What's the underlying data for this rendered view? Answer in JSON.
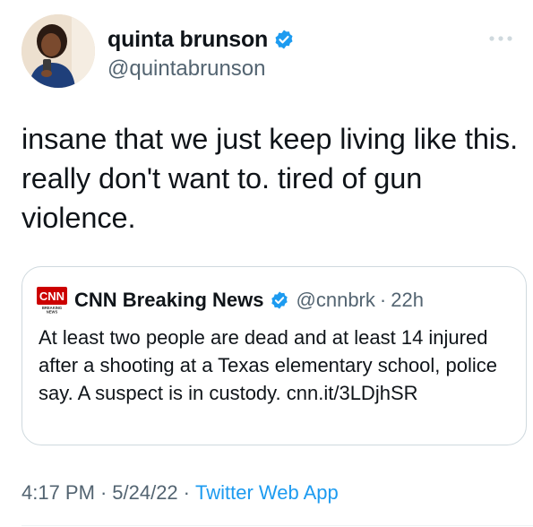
{
  "tweet": {
    "author": {
      "display_name": "quinta brunson",
      "handle": "@quintabrunson",
      "verified": true
    },
    "more_icon": "more-horizontal-icon",
    "text": "insane that we just keep living like this. really don't want to. tired of gun violence.",
    "quoted": {
      "logo_text": "CNN",
      "logo_subtext": "BREAKING NEWS",
      "display_name": "CNN Breaking News",
      "handle": "@cnnbrk",
      "separator": "·",
      "time": "22h",
      "text": "At least two people are dead and at least 14 injured after a shooting at a Texas elementary school, police say. A suspect is in custody. cnn.it/3LDjhSR"
    },
    "meta": {
      "time": "4:17 PM",
      "separator": "·",
      "date": "5/24/22",
      "source": "Twitter Web App"
    }
  },
  "colors": {
    "text_primary": "#0f1419",
    "text_secondary": "#536471",
    "accent": "#1d9bf0",
    "border": "#cfd9de",
    "cnn_red": "#cc0000"
  }
}
